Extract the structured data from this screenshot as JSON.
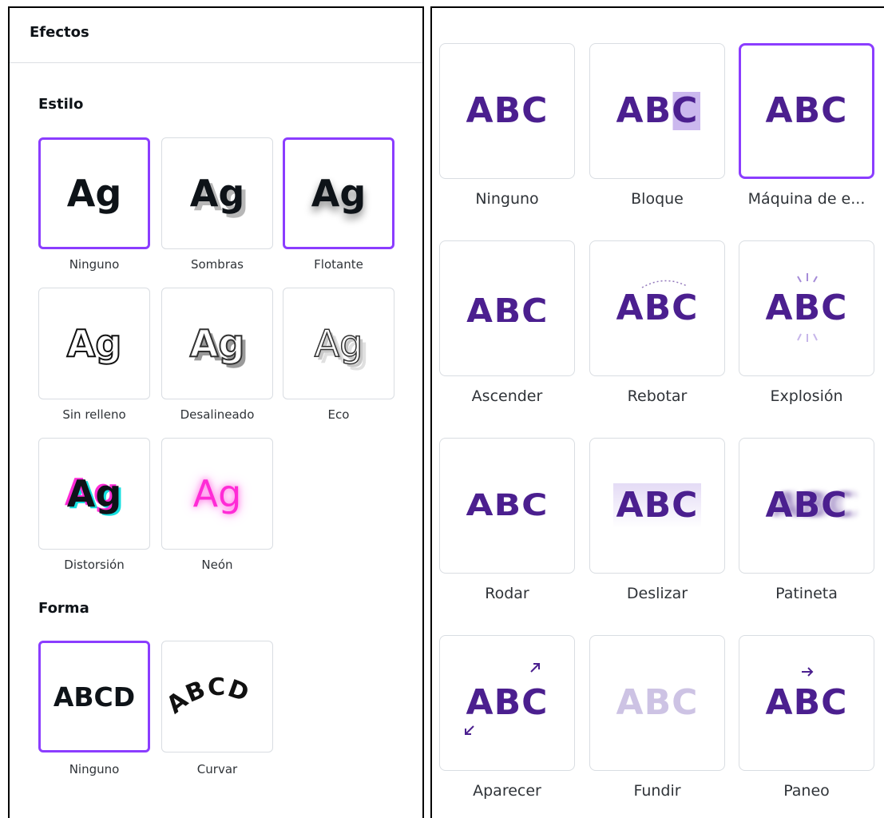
{
  "panel": {
    "title": "Efectos"
  },
  "estilo": {
    "title": "Estilo",
    "items": [
      {
        "label": "Ninguno",
        "preview": "Ag"
      },
      {
        "label": "Sombras",
        "preview": "Ag"
      },
      {
        "label": "Flotante",
        "preview": "Ag"
      },
      {
        "label": "Sin relleno",
        "preview": "Ag"
      },
      {
        "label": "Desalineado",
        "preview": "Ag"
      },
      {
        "label": "Eco",
        "preview": "Ag"
      },
      {
        "label": "Distorsión",
        "preview": "Ag"
      },
      {
        "label": "Neón",
        "preview": "Ag"
      }
    ]
  },
  "forma": {
    "title": "Forma",
    "items": [
      {
        "label": "Ninguno",
        "preview": "ABCD"
      },
      {
        "label": "Curvar",
        "preview": "ABCD"
      }
    ]
  },
  "animations": {
    "items": [
      {
        "label": "Ninguno",
        "preview": "ABC"
      },
      {
        "label": "Bloque",
        "preview": "ABC"
      },
      {
        "label": "Máquina de e...",
        "preview": "ABC"
      },
      {
        "label": "Ascender",
        "preview": "ABC"
      },
      {
        "label": "Rebotar",
        "preview": "ABC"
      },
      {
        "label": "Explosión",
        "preview": "ABC"
      },
      {
        "label": "Rodar",
        "preview": "ABC"
      },
      {
        "label": "Deslizar",
        "preview": "ABC"
      },
      {
        "label": "Patineta",
        "preview": "ABC"
      },
      {
        "label": "Aparecer",
        "preview": "ABC"
      },
      {
        "label": "Fundir",
        "preview": "ABC"
      },
      {
        "label": "Paneo",
        "preview": "ABC"
      }
    ]
  },
  "colors": {
    "accent": "#8b3dff",
    "animation_text": "#4b1f8f",
    "neon": "#ff2bd6",
    "glitch_cyan": "#16e0e0"
  }
}
